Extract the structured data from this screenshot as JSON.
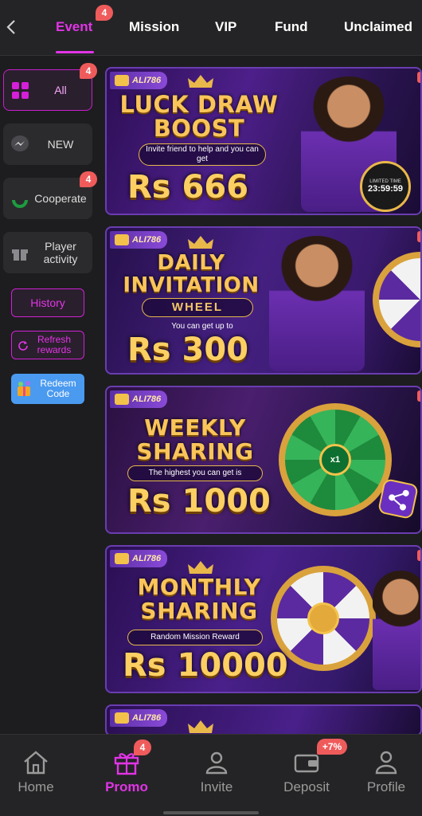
{
  "tabs": [
    {
      "label": "Event",
      "badge": "4",
      "active": true
    },
    {
      "label": "Mission"
    },
    {
      "label": "VIP"
    },
    {
      "label": "Fund"
    },
    {
      "label": "Unclaimed"
    }
  ],
  "sidebar": {
    "items": [
      {
        "label": "All",
        "icon": "grid-icon",
        "badge": "4",
        "active": true
      },
      {
        "label": "NEW",
        "icon": "messenger-icon"
      },
      {
        "label": "Cooperate",
        "icon": "refresh-icon",
        "badge": "4"
      },
      {
        "label": "Player activity",
        "icon": "gift-icon"
      }
    ],
    "history_label": "History",
    "refresh_label": "Refresh rewards",
    "redeem_label": "Redeem Code"
  },
  "banners": [
    {
      "brand": "ALI786",
      "title_line1": "LUCK DRAW",
      "title_line2": "BOOST",
      "subtitle": "Invite friend to help and you can get",
      "amount": "Rs 666",
      "timer_label": "LIMITED TIME",
      "timer": "23:59:59"
    },
    {
      "brand": "ALI786",
      "title_line1": "DAILY",
      "title_line2": "INVITATION",
      "title_line3": "WHEEL",
      "subtitle": "You can get up to",
      "amount": "Rs 300"
    },
    {
      "brand": "ALI786",
      "title_line1": "WEEKLY",
      "title_line2": "SHARING",
      "subtitle": "The highest you can get is",
      "amount": "Rs 1000",
      "wheel_center": "x1"
    },
    {
      "brand": "ALI786",
      "title_line1": "MONTHLY",
      "title_line2": "SHARING",
      "subtitle": "Random Mission Reward",
      "amount": "Rs 10000"
    },
    {
      "brand": "ALI786"
    }
  ],
  "bottom_nav": [
    {
      "label": "Home",
      "icon": "home-icon"
    },
    {
      "label": "Promo",
      "icon": "gift-icon",
      "badge": "4",
      "active": true
    },
    {
      "label": "Invite",
      "icon": "users-icon"
    },
    {
      "label": "Deposit",
      "icon": "wallet-icon",
      "badge": "+7%"
    },
    {
      "label": "Profile",
      "icon": "profile-icon"
    }
  ],
  "colors": {
    "accent": "#e134e6",
    "badge": "#ef5b5b",
    "background": "#1d1d1f",
    "gold": "#f9c55a"
  }
}
